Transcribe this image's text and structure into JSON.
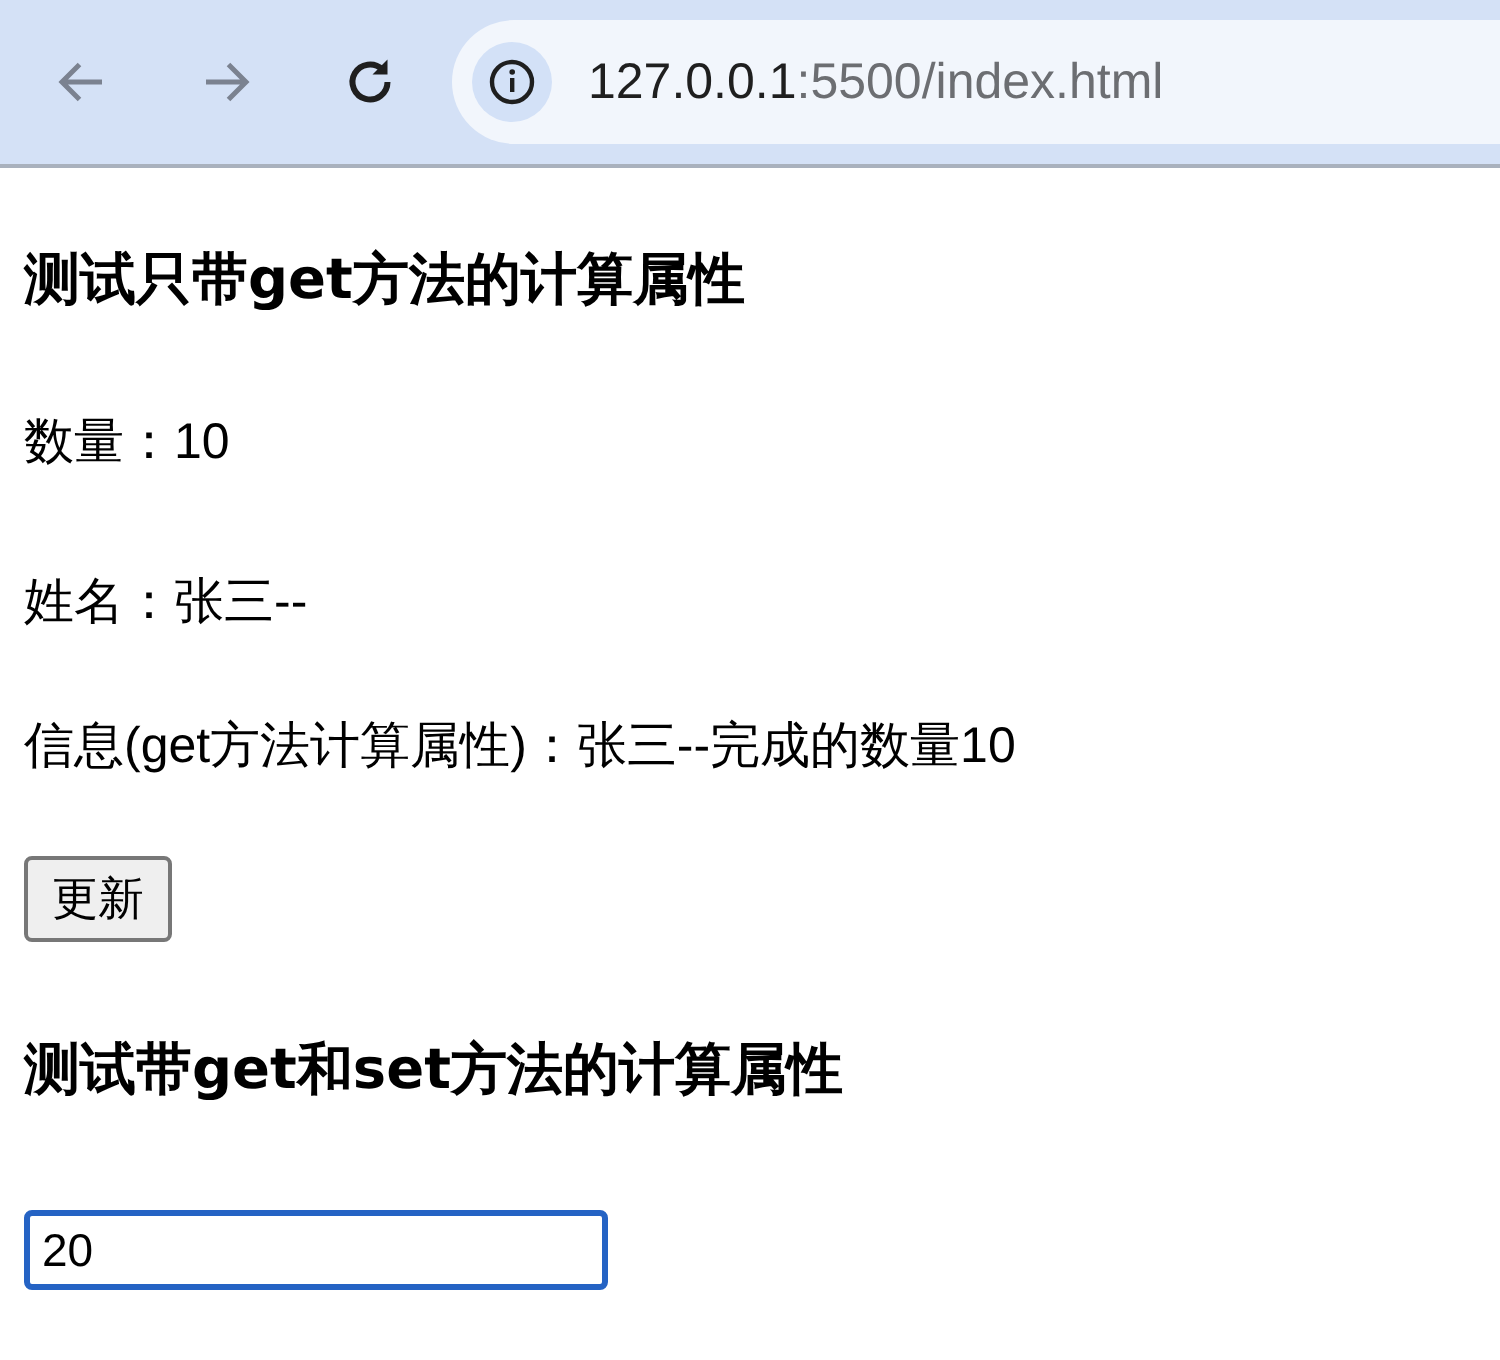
{
  "browser": {
    "url_host": "127.0.0.1",
    "url_path": ":5500/index.html"
  },
  "section_1": {
    "heading": "测试只带get方法的计算属性",
    "lines": [
      "数量：10",
      "姓名：张三--",
      "信息(get方法计算属性)：张三--完成的数量10"
    ],
    "button": "更新"
  },
  "section_2": {
    "heading": "测试带get和set方法的计算属性",
    "input": {
      "value": "20",
      "focused": true
    }
  }
}
